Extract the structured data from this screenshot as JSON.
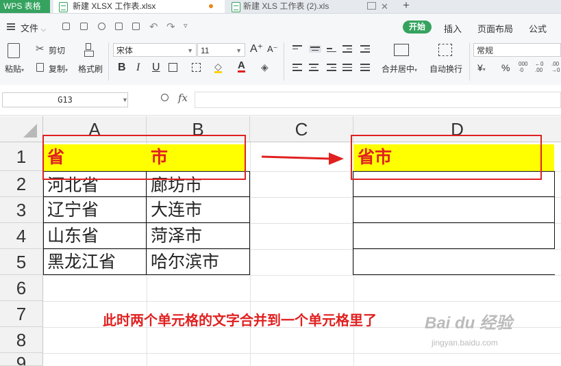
{
  "app": {
    "name": "WPS 表格"
  },
  "tabs": [
    {
      "label": "新建 XLSX 工作表.xlsx"
    },
    {
      "label": "新建 XLS 工作表 (2).xls"
    }
  ],
  "menu": {
    "file": "文件",
    "file_chevron": "⌵",
    "tabs": [
      "开始",
      "插入",
      "页面布局",
      "公式"
    ]
  },
  "ribbon": {
    "paste": "粘贴",
    "cut": "剪切",
    "copy": "复制",
    "format_painter": "格式刷",
    "font_name": "宋体",
    "font_size": "11",
    "merge_center": "合并居中",
    "wrap_text": "自动换行",
    "number_format": "常规",
    "currency_symbol": "¥",
    "percent_symbol": "%",
    "bold": "B",
    "italic": "I",
    "underline": "U",
    "font_grow": "A⁺",
    "font_shrink": "A⁻"
  },
  "formula_bar": {
    "name_box": "G13",
    "fx": "fx",
    "formula": ""
  },
  "grid": {
    "columns": [
      "A",
      "B",
      "C",
      "D"
    ],
    "rows": [
      "1",
      "2",
      "3",
      "4",
      "5",
      "6",
      "7",
      "8",
      "9"
    ],
    "header": {
      "a": "省",
      "b": "市",
      "d": "省市"
    },
    "data": [
      {
        "a": "河北省",
        "b": "廊坊市"
      },
      {
        "a": "辽宁省",
        "b": "大连市"
      },
      {
        "a": "山东省",
        "b": "菏泽市"
      },
      {
        "a": "黑龙江省",
        "b": "哈尔滨市"
      }
    ]
  },
  "annotation": {
    "caption": "此时两个单元格的文字合并到一个单元格里了"
  },
  "watermark": {
    "main": "Bai du 经验",
    "sub": "jingyan.baidu.com"
  },
  "colors": {
    "accent": "#35a35f",
    "header_fill": "#ffff00",
    "header_text": "#e02020",
    "annotation": "#e02020"
  }
}
